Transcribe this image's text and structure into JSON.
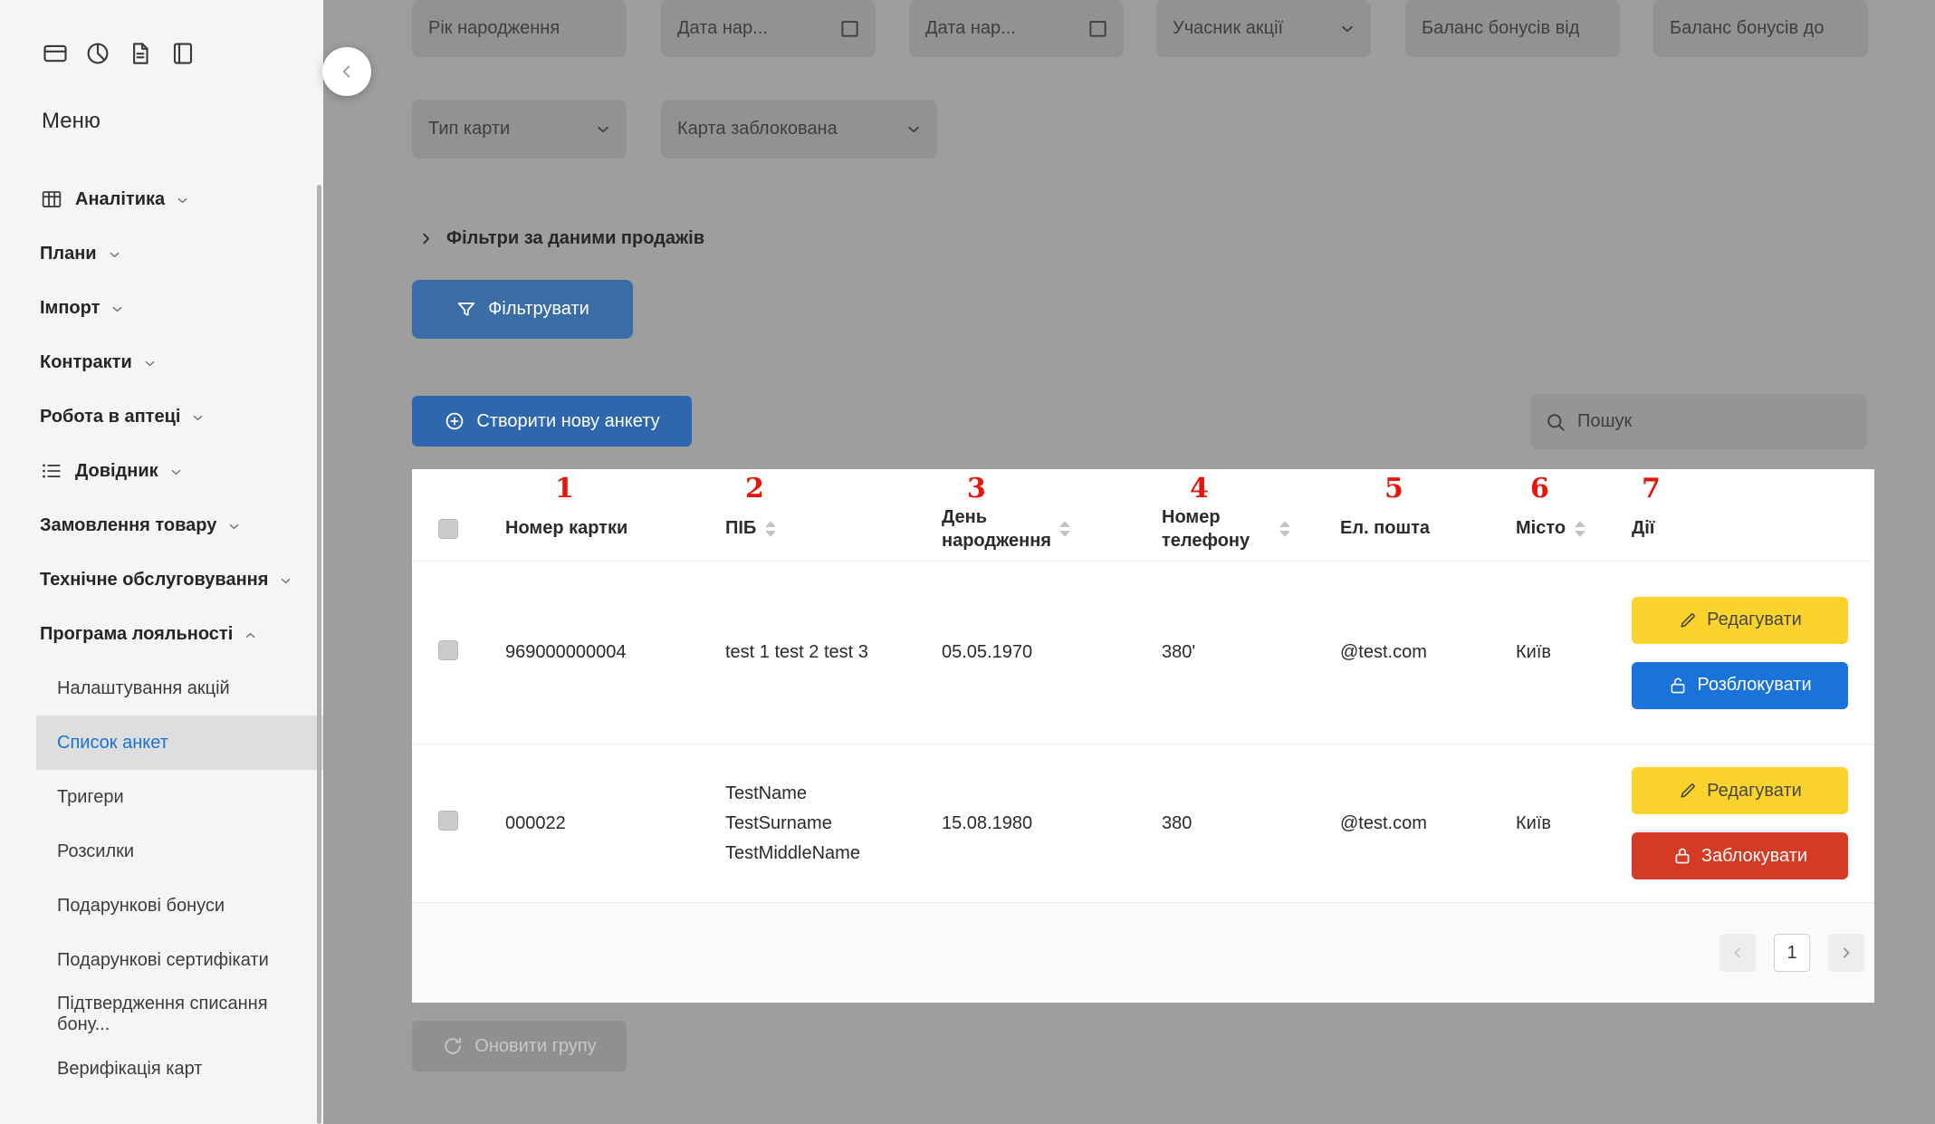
{
  "sidebar": {
    "menu_title": "Меню",
    "top_icons": [
      "card-icon",
      "pie-chart-icon",
      "file-icon",
      "book-icon"
    ],
    "items": [
      {
        "label": "Аналітика"
      },
      {
        "label": "Плани"
      },
      {
        "label": "Імпорт"
      },
      {
        "label": "Контракти"
      },
      {
        "label": "Робота в аптеці"
      },
      {
        "label": "Довідник"
      },
      {
        "label": "Замовлення товару"
      },
      {
        "label": "Технічне обслуговування"
      },
      {
        "label": "Програма лояльності"
      }
    ],
    "subitems": [
      {
        "label": "Налаштування акцій"
      },
      {
        "label": "Список анкет"
      },
      {
        "label": "Тригери"
      },
      {
        "label": "Розсилки"
      },
      {
        "label": "Подарункові бонуси"
      },
      {
        "label": "Подарункові сертифікати"
      },
      {
        "label": "Підтвердження списання бону..."
      },
      {
        "label": "Верифікація карт"
      }
    ],
    "active_subitem": "Список анкет"
  },
  "filters": {
    "year_placeholder": "Рік народження",
    "date_from_placeholder": "Дата нар...",
    "date_to_placeholder": "Дата нар...",
    "promo_participant_placeholder": "Учасник акції",
    "bonus_from_placeholder": "Баланс бонусів від",
    "bonus_to_placeholder": "Баланс бонусів до",
    "card_type_placeholder": "Тип карти",
    "card_blocked_placeholder": "Карта заблокована",
    "sales_filters_label": "Фільтри за даними продажів",
    "filter_button_label": "Фільтрувати"
  },
  "toolbar": {
    "create_button_label": "Створити нову анкету",
    "search_placeholder": "Пошук",
    "update_group_label": "Оновити групу"
  },
  "table": {
    "annotations": [
      "1",
      "2",
      "3",
      "4",
      "5",
      "6",
      "7"
    ],
    "columns": [
      {
        "label": "Номер картки"
      },
      {
        "label": "ПІБ"
      },
      {
        "label": "День народження"
      },
      {
        "label": "Номер телефону"
      },
      {
        "label": "Ел. пошта"
      },
      {
        "label": "Місто"
      },
      {
        "label": "Дії"
      }
    ],
    "rows": [
      {
        "card_number": "969000000004",
        "name_lines": [
          "test 1 test 2 test 3"
        ],
        "birth_date": "05.05.1970",
        "phone": "380'",
        "email": "@test.com",
        "city": "Київ",
        "actions": [
          {
            "label": "Редагувати"
          },
          {
            "label": "Розблокувати"
          }
        ]
      },
      {
        "card_number": "000022",
        "name_lines": [
          "TestName",
          "TestSurname",
          "TestMiddleName"
        ],
        "birth_date": "15.08.1980",
        "phone": "380",
        "email": "@test.com",
        "city": "Київ",
        "actions": [
          {
            "label": "Редагувати"
          },
          {
            "label": "Заблокувати"
          }
        ]
      }
    ],
    "pagination": {
      "current_page": "1"
    }
  },
  "colors": {
    "page_bg": "#9e9e9e",
    "filter_button": "#3a6da6",
    "create_button": "#2f67ae",
    "edit_button": "#fcd32d",
    "unblock_button": "#1a73d8",
    "block_button": "#d43a24",
    "active_link": "#1673d2",
    "annotation_red": "#e8150d"
  }
}
